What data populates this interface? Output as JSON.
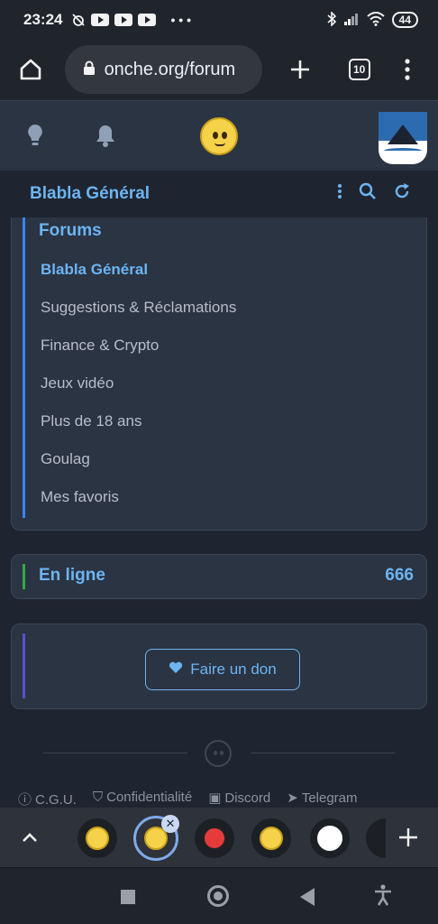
{
  "status_bar": {
    "time": "23:24",
    "battery": "44"
  },
  "browser": {
    "url": "onche.org/forum",
    "tab_count": "10"
  },
  "forum_header": {
    "title": "Blabla Général"
  },
  "forums": {
    "title": "Forums",
    "items": [
      {
        "label": "Blabla Général",
        "active": true
      },
      {
        "label": "Suggestions & Réclamations",
        "active": false
      },
      {
        "label": "Finance & Crypto",
        "active": false
      },
      {
        "label": "Jeux vidéo",
        "active": false
      },
      {
        "label": "Plus de 18 ans",
        "active": false
      },
      {
        "label": "Goulag",
        "active": false
      },
      {
        "label": "Mes favoris",
        "active": false
      }
    ]
  },
  "online": {
    "label": "En ligne",
    "count": "666"
  },
  "donation": {
    "button_label": "Faire un don"
  },
  "footer": {
    "links": [
      "C.G.U.",
      "Confidentialité",
      "Discord",
      "Telegram"
    ]
  },
  "colors": {
    "accent_blue": "#6db4f2",
    "page_bg": "#1f2530",
    "card_bg": "#2a3443"
  }
}
